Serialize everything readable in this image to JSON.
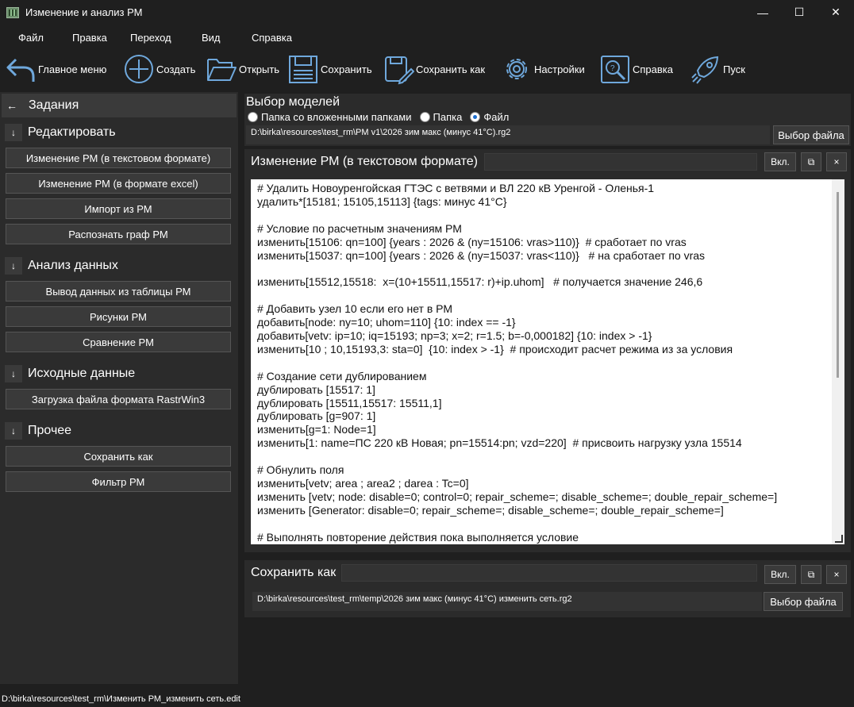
{
  "window": {
    "title": "Изменение и анализ РМ",
    "minimize": "—",
    "maximize": "☐",
    "close": "✕"
  },
  "menu": [
    "Файл",
    "Правка",
    "Переход",
    "Вид",
    "Справка"
  ],
  "toolbar": {
    "main_menu": "Главное меню",
    "create": "Создать",
    "open": "Открыть",
    "save": "Сохранить",
    "save_as": "Сохранить как",
    "settings": "Настройки",
    "help": "Справка",
    "run": "Пуск"
  },
  "sidebar": {
    "back_arrow": "←",
    "header": "Задания",
    "section_arrow": "↓",
    "sections": [
      {
        "label": "Редактировать",
        "items": [
          "Изменение РМ (в текстовом формате)",
          "Изменение РМ (в формате excel)",
          "Импорт из РМ",
          "Распознать граф РМ"
        ]
      },
      {
        "label": "Анализ данных",
        "items": [
          "Вывод данных из таблицы РМ",
          "Рисунки РМ",
          "Сравнение РМ"
        ]
      },
      {
        "label": "Исходные данные",
        "items": [
          "Загрузка файла формата RastrWin3"
        ]
      },
      {
        "label": "Прочее",
        "items": [
          "Сохранить как",
          "Фильтр РМ"
        ]
      }
    ]
  },
  "model_select": {
    "title": "Выбор моделей",
    "radio_subfolders": "Папка со вложенными папками",
    "radio_folder": "Папка",
    "radio_file": "Файл",
    "selected": "Файл",
    "path": "D:\\birka\\resources\\test_rm\\PM v1\\2026 зим макс (минус 41°С).rg2",
    "file_button": "Выбор файла"
  },
  "edit_panel": {
    "title": "Изменение РМ (в текстовом формате)",
    "toggle_label": "Вкл.",
    "copy_icon": "⧉",
    "close_icon": "×",
    "lines": [
      "# Удалить Новоуренгойская ГТЭС с ветвями и ВЛ 220 кВ Уренгой - Оленья-1",
      "удалить*[15181; 15105,15113] {tags: минус 41°С}",
      "",
      "# Условие по расчетным значениям РМ",
      "изменить[15106: qn=100] {years : 2026 & (ny=15106: vras>110)}  # сработает по vras",
      "изменить[15037: qn=100] {years : 2026 & (ny=15037: vras<110)}   # на сработает по vras",
      "",
      "изменить[15512,15518:  x=(10+15511,15517: r)+ip.uhom]   # получается значение 246,6",
      "",
      "# Добавить узел 10 если его нет в РМ",
      "добавить[node: ny=10; uhom=110] {10: index == -1}",
      "добавить[vetv: ip=10; iq=15193; np=3; x=2; r=1.5; b=-0,000182] {10: index > -1}",
      "изменить[10 ; 10,15193,3: sta=0]  {10: index > -1}  # происходит расчет режима из за условия",
      "",
      "# Создание сети дублированием",
      "дублировать [15517: 1]",
      "дублировать [15511,15517: 15511,1]",
      "дублировать [g=907: 1]",
      "изменить[g=1: Node=1]",
      "изменить[1: name=ПС 220 кВ Новая; pn=15514:pn; vzd=220]  # присвоить нагрузку узла 15514",
      "",
      "# Обнулить поля",
      "изменить[vetv; area ; area2 ; darea : Tc=0]",
      "изменить [vetv; node: disable=0; control=0; repair_scheme=; disable_scheme=; double_repair_scheme=]",
      "изменить [Generator: disable=0; repair_scheme=; disable_scheme=; double_repair_scheme=]",
      "",
      "# Выполнять повторение действия пока выполняется условие"
    ]
  },
  "save_panel": {
    "title": "Сохранить как",
    "toggle_label": "Вкл.",
    "copy_icon": "⧉",
    "close_icon": "×",
    "path": "D:\\birka\\resources\\test_rm\\temp\\2026 зим макс (минус 41°С) изменить сеть.rg2",
    "file_button": "Выбор файла"
  },
  "status": {
    "path": "D:\\birka\\resources\\test_rm\\Изменить РМ_изменить сеть.edit"
  },
  "colors": {
    "background": "#1f1f1f",
    "panel": "#2b2b2b",
    "button": "#3a3a3a",
    "icon_blue": "#6fa8dc"
  }
}
